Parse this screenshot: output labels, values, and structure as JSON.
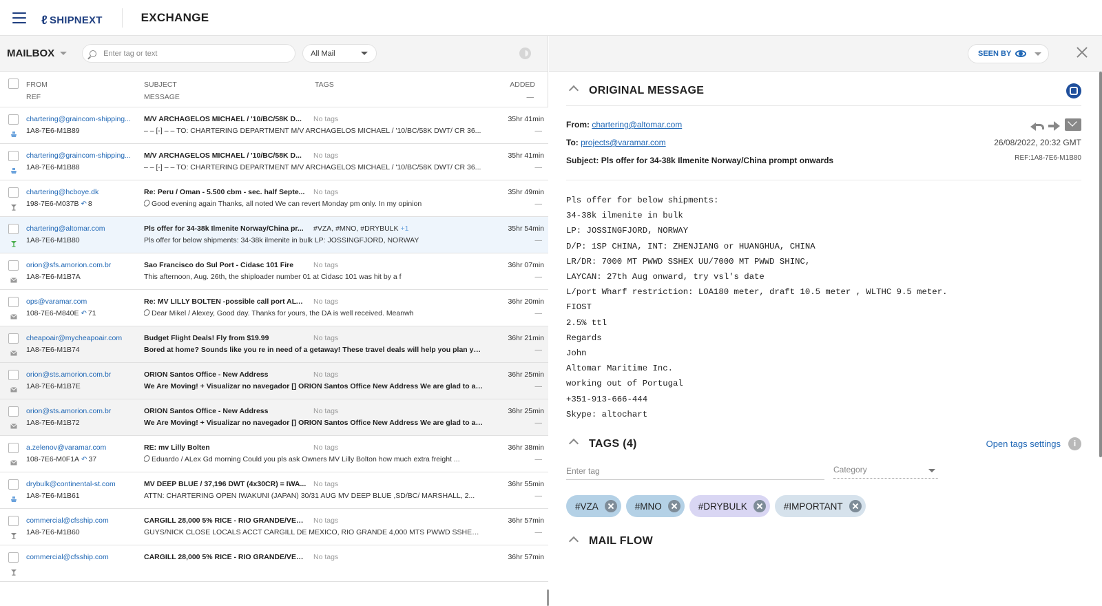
{
  "header": {
    "logo_text": "SHIPNEXT",
    "app_title": "EXCHANGE",
    "brand_color": "#1f3f80"
  },
  "toolbar": {
    "mailbox_label": "MAILBOX",
    "search_placeholder": "Enter tag or text",
    "filter_value": "All Mail"
  },
  "columns": {
    "from": "FROM",
    "ref": "REF",
    "subject": "SUBJECT",
    "message": "MESSAGE",
    "tags": "TAGS",
    "added": "ADDED",
    "added_sub": "—"
  },
  "rows": [
    {
      "from": "chartering@graincom-shipping...",
      "ref": "1A8-7E6-M1B89",
      "reply_count": "",
      "subject": "M/V ARCHAGELOS MICHAEL / '10/BC/58K D...",
      "tags": "No tags",
      "tags_extra": "",
      "message": "– – [-] – – TO: CHARTERING DEPARTMENT M/V ARCHAGELOS MICHAEL / '10/BC/58K DWT/ CR 36...",
      "time": "35hr 41min",
      "dash": "—",
      "icon": "ship-icon",
      "attach": false
    },
    {
      "from": "chartering@graincom-shipping...",
      "ref": "1A8-7E6-M1B88",
      "reply_count": "",
      "subject": "M/V ARCHAGELOS MICHAEL / '10/BC/58K D...",
      "tags": "No tags",
      "tags_extra": "",
      "message": "– – [-] – – TO: CHARTERING DEPARTMENT M/V ARCHAGELOS MICHAEL / '10/BC/58K DWT/ CR 36...",
      "time": "35hr 41min",
      "dash": "—",
      "icon": "ship-icon",
      "attach": false
    },
    {
      "from": "chartering@hcboye.dk",
      "ref": "198-7E6-M037B",
      "reply_count": "8",
      "subject": "Re: Peru / Oman - 5.500 cbm - sec. half Septe...",
      "tags": "No tags",
      "tags_extra": "",
      "message": "Good evening again Thanks, all noted We can revert Monday pm only. In my opinion",
      "time": "35hr 49min",
      "dash": "—",
      "icon": "cargo-icon",
      "attach": true
    },
    {
      "from": "chartering@altomar.com",
      "ref": "1A8-7E6-M1B80",
      "reply_count": "",
      "subject": "Pls offer for 34-38k Ilmenite Norway/China pr...",
      "tags": "#VZA, #MNO, #DRYBULK",
      "tags_extra": "+1",
      "message": "Pls offer for below shipments: 34-38k ilmenite in bulk LP: JOSSINGFJORD, NORWAY",
      "time": "35hr 54min",
      "dash": "—",
      "icon": "cargo-icon",
      "attach": false
    },
    {
      "from": "orion@sfs.amorion.com.br",
      "ref": "1A8-7E6-M1B7A",
      "reply_count": "",
      "subject": "Sao Francisco do Sul Port - Cidasc 101 Fire",
      "tags": "No tags",
      "tags_extra": "",
      "message": "This afternoon, Aug. 26th, the shiploader number 01 at Cidasc 101 was hit by a f",
      "time": "36hr 07min",
      "dash": "—",
      "icon": "mail-icon",
      "attach": false
    },
    {
      "from": "ops@varamar.com",
      "ref": "108-7E6-M840E",
      "reply_count": "71",
      "subject": "Re: MV LILLY BOLTEN -possible call port ALTA...",
      "tags": "No tags",
      "tags_extra": "",
      "message": "Dear Mikel / Alexey, Good day. Thanks for yours, the DA is well received. Meanwh",
      "time": "36hr 20min",
      "dash": "—",
      "icon": "mail-icon",
      "attach": true
    },
    {
      "from": "cheapoair@mycheapoair.com",
      "ref": "1A8-7E6-M1B74",
      "reply_count": "",
      "subject": "Budget Flight Deals! Fly from $19.99",
      "tags": "No tags",
      "tags_extra": "",
      "message": "Bored at home? Sounds like you re in need of a getaway! These travel deals will help you plan you...",
      "time": "36hr 21min",
      "dash": "—",
      "icon": "mail-icon",
      "attach": false
    },
    {
      "from": "orion@sts.amorion.com.br",
      "ref": "1A8-7E6-M1B7E",
      "reply_count": "",
      "subject": "ORION Santos Office - New Address",
      "tags": "No tags",
      "tags_extra": "",
      "message": "We Are Moving! + Visualizar no navegador [] ORION Santos Office New Address We are glad to an...",
      "time": "36hr 25min",
      "dash": "—",
      "icon": "mail-icon",
      "attach": false
    },
    {
      "from": "orion@sts.amorion.com.br",
      "ref": "1A8-7E6-M1B72",
      "reply_count": "",
      "subject": "ORION Santos Office - New Address",
      "tags": "No tags",
      "tags_extra": "",
      "message": "We Are Moving! + Visualizar no navegador [] ORION Santos Office New Address We are glad to an...",
      "time": "36hr 25min",
      "dash": "—",
      "icon": "mail-icon",
      "attach": false
    },
    {
      "from": "a.zelenov@varamar.com",
      "ref": "108-7E6-M0F1A",
      "reply_count": "37",
      "subject": "RE: mv Lilly Bolten",
      "tags": "No tags",
      "tags_extra": "",
      "message": "Eduardo / ALex Gd morning Could you pls ask Owners MV Lilly Bolton how much extra freight ...",
      "time": "36hr 38min",
      "dash": "—",
      "icon": "mail-icon",
      "attach": true
    },
    {
      "from": "drybulk@continental-st.com",
      "ref": "1A8-7E6-M1B61",
      "reply_count": "",
      "subject": "MV DEEP BLUE / 37,196 DWT (4x30CR) = IWA...",
      "tags": "No tags",
      "tags_extra": "",
      "message": "ATTN: CHARTERING OPEN IWAKUNI (JAPAN) 30/31 AUG MV DEEP BLUE ,SD/BC/ MARSHALL, 2...",
      "time": "36hr 55min",
      "dash": "—",
      "icon": "ship-icon",
      "attach": false
    },
    {
      "from": "commercial@cfsship.com",
      "ref": "1A8-7E6-M1B60",
      "reply_count": "",
      "subject": "CARGILL 28,000 5% RICE - RIO GRANDE/VER...",
      "tags": "No tags",
      "tags_extra": "",
      "message": "GUYS/NICK CLOSE LOCALS ACCT CARGILL DE MEXICO, RIO GRANDE 4,000 MTS PWWD SSHEX ...",
      "time": "36hr 57min",
      "dash": "—",
      "icon": "cargo-icon",
      "attach": false
    },
    {
      "from": "commercial@cfsship.com",
      "ref": "",
      "reply_count": "",
      "subject": "CARGILL 28,000 5% RICE - RIO GRANDE/VER...",
      "tags": "No tags",
      "tags_extra": "",
      "message": "",
      "time": "36hr 57min",
      "dash": "",
      "icon": "cargo-icon",
      "attach": false
    }
  ],
  "detail": {
    "seen_by_label": "SEEN BY",
    "original_message_title": "ORIGINAL MESSAGE",
    "from_label": "From:",
    "from_email": "chartering@altomar.com",
    "to_label": "To:",
    "to_email": "projects@varamar.com",
    "subject_label": "Subject:",
    "subject": "Pls offer for 34-38k Ilmenite Norway/China prompt onwards",
    "date": "26/08/2022, 20:32 GMT",
    "ref": "REF:1A8-7E6-M1B80",
    "body_lines": [
      "Pls offer for below shipments:",
      "34-38k ilmenite in bulk",
      "LP: JOSSINGFJORD, NORWAY",
      "D/P: 1SP CHINA, INT: ZHENJIANG or HUANGHUA, CHINA",
      "LR/DR: 7000 MT PWWD SSHEX UU/7000 MT PWWD SHINC,",
      "LAYCAN: 27th Aug onward, try vsl's date",
      "L/port Wharf restriction: LOA180 meter, draft 10.5 meter , WLTHC 9.5 meter.",
      "FIOST",
      "2.5% ttl",
      "Regards",
      "John",
      "Altomar Maritime Inc.",
      "working out of Portugal",
      "+351-913-666-444",
      "Skype: altochart"
    ],
    "tags_title": "TAGS (4)",
    "open_tags_settings": "Open tags settings",
    "tag_input_placeholder": "Enter tag",
    "category_placeholder": "Category",
    "chips": [
      {
        "label": "#VZA",
        "color": "#b4d1e6"
      },
      {
        "label": "#MNO",
        "color": "#b4d1e6"
      },
      {
        "label": "#DRYBULK",
        "color": "#d9d6f3"
      },
      {
        "label": "#IMPORTANT",
        "color": "#d6e2ec"
      }
    ],
    "mail_flow_title": "MAIL FLOW"
  }
}
